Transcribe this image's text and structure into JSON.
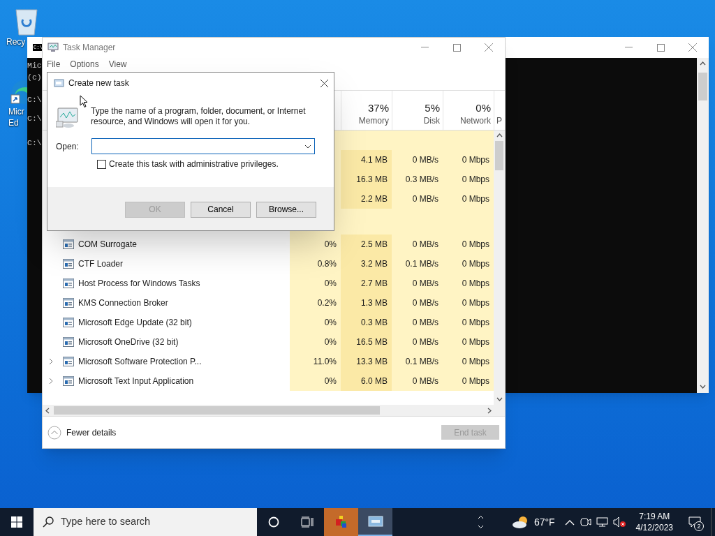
{
  "desktop_icons": [
    {
      "label_lines": [
        "Recy"
      ]
    },
    {
      "label_lines": [
        "Micr",
        "Ed"
      ]
    }
  ],
  "console": {
    "title_icon_text": "C:\\",
    "lines": [
      "Mic",
      "(c)",
      "C:\\",
      "C:\\",
      "C:\\"
    ]
  },
  "task_manager": {
    "title": "Task Manager",
    "menu": [
      "File",
      "Options",
      "View"
    ],
    "columns": [
      {
        "percent": "37%",
        "label": "Memory"
      },
      {
        "percent": "5%",
        "label": "Disk"
      },
      {
        "percent": "0%",
        "label": "Network"
      },
      {
        "label": "P"
      }
    ],
    "app_rows": [
      {
        "memory": "4.1 MB",
        "disk": "0 MB/s",
        "network": "0 Mbps"
      },
      {
        "memory": "16.3 MB",
        "disk": "0.3 MB/s",
        "network": "0 Mbps"
      },
      {
        "memory": "2.2 MB",
        "disk": "0 MB/s",
        "network": "0 Mbps"
      }
    ],
    "background_rows": [
      {
        "name": "COM Surrogate",
        "cpu": "0%",
        "memory": "2.5 MB",
        "disk": "0 MB/s",
        "network": "0 Mbps",
        "expandable": false
      },
      {
        "name": "CTF Loader",
        "cpu": "0.8%",
        "memory": "3.2 MB",
        "disk": "0.1 MB/s",
        "network": "0 Mbps",
        "expandable": false
      },
      {
        "name": "Host Process for Windows Tasks",
        "cpu": "0%",
        "memory": "2.7 MB",
        "disk": "0 MB/s",
        "network": "0 Mbps",
        "expandable": false
      },
      {
        "name": "KMS Connection Broker",
        "cpu": "0.2%",
        "memory": "1.3 MB",
        "disk": "0 MB/s",
        "network": "0 Mbps",
        "expandable": false
      },
      {
        "name": "Microsoft Edge Update (32 bit)",
        "cpu": "0%",
        "memory": "0.3 MB",
        "disk": "0 MB/s",
        "network": "0 Mbps",
        "expandable": false
      },
      {
        "name": "Microsoft OneDrive (32 bit)",
        "cpu": "0%",
        "memory": "16.5 MB",
        "disk": "0 MB/s",
        "network": "0 Mbps",
        "expandable": false
      },
      {
        "name": "Microsoft Software Protection P...",
        "cpu": "11.0%",
        "memory": "13.3 MB",
        "disk": "0.1 MB/s",
        "network": "0 Mbps",
        "expandable": true
      },
      {
        "name": "Microsoft Text Input Application",
        "cpu": "0%",
        "memory": "6.0 MB",
        "disk": "0 MB/s",
        "network": "0 Mbps",
        "expandable": true
      }
    ],
    "fewer_details": "Fewer details",
    "end_task": {
      "label": "End task",
      "disabled": true
    }
  },
  "dialog": {
    "title": "Create new task",
    "prompt": "Type the name of a program, folder, document, or Internet resource, and Windows will open it for you.",
    "open_label": "Open:",
    "admin_checkbox": {
      "label": "Create this task with administrative privileges.",
      "checked": false
    },
    "buttons": [
      {
        "label": "OK",
        "disabled": true
      },
      {
        "label": "Cancel",
        "disabled": false
      },
      {
        "label": "Browse...",
        "disabled": false
      }
    ]
  },
  "taskbar": {
    "search_placeholder": "Type here to search",
    "apps": [
      {
        "flashing": true,
        "active": false
      },
      {
        "flashing": false,
        "active": true
      }
    ],
    "temperature": "67°F",
    "time": "7:19 AM",
    "date": "4/12/2023",
    "notification_count": "2"
  }
}
